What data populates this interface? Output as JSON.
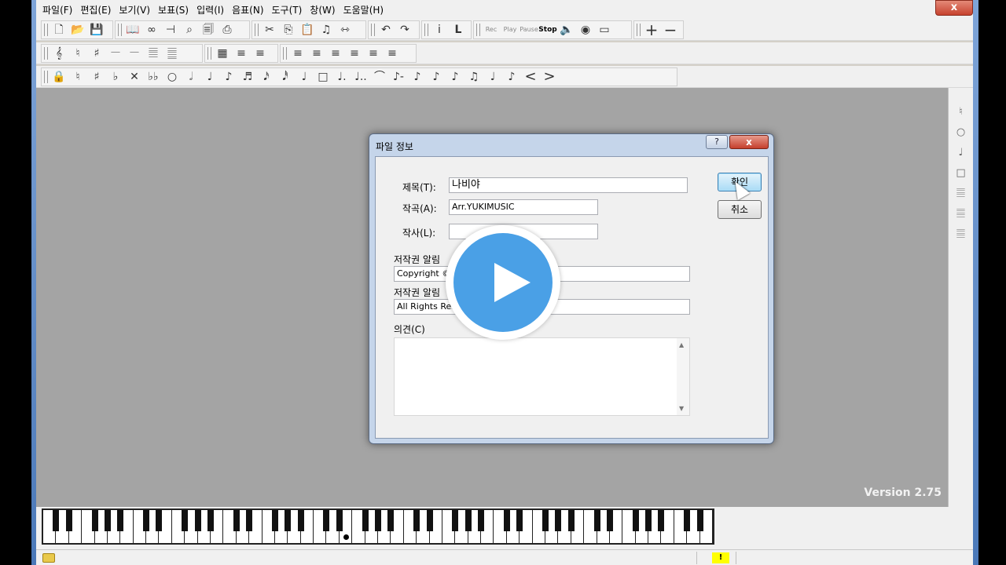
{
  "menu": [
    "파일(F)",
    "편집(E)",
    "보기(V)",
    "보표(S)",
    "입력(I)",
    "음표(N)",
    "도구(T)",
    "창(W)",
    "도움말(H)"
  ],
  "window_close_glyph": "x",
  "toolbar1": {
    "group1": [
      "new-file-icon",
      "open-folder-icon",
      "save-icon"
    ],
    "group2": [
      "book-icon",
      "glasses-icon",
      "indent-icon",
      "magnifier-icon",
      "preview-icon",
      "print-icon"
    ],
    "group3": [
      "cut-icon",
      "copy-icon",
      "paste-icon",
      "music-note-icon",
      "link-icon"
    ],
    "group4": [
      "undo-icon",
      "redo-icon"
    ],
    "group5": [
      "info-icon",
      "text-icon"
    ],
    "transport": {
      "rec": "Rec",
      "play": "Play",
      "pause": "Pause",
      "stop": "Stop"
    },
    "group6": [
      "speaker-icon",
      "globe-icon",
      "keyboard-icon"
    ],
    "zoom": [
      "+",
      "−"
    ]
  },
  "toolbar2": {
    "group1": [
      "𝄞",
      "♮",
      "♯",
      "𝄖",
      "𝄖",
      "𝄚",
      "𝄛"
    ],
    "group2": [
      "▦",
      "≡",
      "≡"
    ],
    "group3": [
      "≡",
      "≡",
      "≡",
      "≡",
      "≡",
      "≡"
    ]
  },
  "toolbar3": {
    "group1": [
      "lock-icon",
      "♮",
      "♯",
      "♭",
      "✕",
      "♭♭",
      "○",
      "𝅗𝅥",
      "♩",
      "♪",
      "♬",
      "𝅘𝅥𝅯",
      "𝅘𝅥𝅰",
      "♩",
      "□",
      "♩.",
      "♩..",
      "⌒",
      "♪-",
      "♪",
      "♪",
      "♪",
      "♫",
      "♩",
      "♪",
      "<",
      ">"
    ]
  },
  "palette": [
    "♮",
    "○",
    "♩",
    "□",
    "𝄚",
    "𝄚",
    "𝄚"
  ],
  "version": "Version 2.75",
  "status": {
    "indicator": "!"
  },
  "dialog": {
    "title": "파일 정보",
    "help": "?",
    "close": "x",
    "fields": {
      "title_label": "제목(T):",
      "title_value": "나비야",
      "composer_label": "작곡(A):",
      "composer_value": "Arr.YUKIMUSIC",
      "lyricist_label": "작사(L):",
      "lyricist_value": "",
      "copyright1_label": "저작권 알림",
      "copyright1_value": "Copyright ©",
      "copyright2_label": "저작권 알림",
      "copyright2_value": "All Rights Res",
      "comments_label": "의견(C)",
      "comments_value": ""
    },
    "ok": "확인",
    "cancel": "취소"
  }
}
